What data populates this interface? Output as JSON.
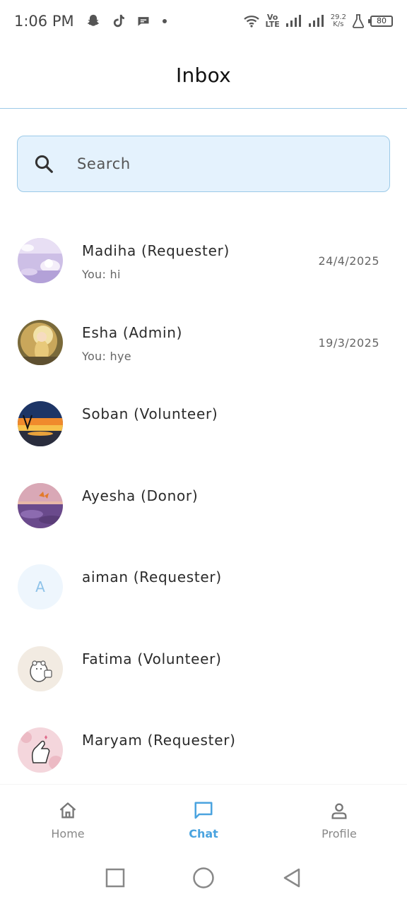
{
  "status_bar": {
    "time": "1:06 PM",
    "network_top": "Vo",
    "network_bottom": "LTE",
    "speed_value": "29.2",
    "speed_unit": "K/s",
    "battery": "80",
    "icons": [
      "snapchat-icon",
      "tiktok-icon",
      "message-icon",
      "dot-icon",
      "wifi-icon",
      "signal-icon",
      "signal-icon",
      "flask-icon",
      "battery-icon"
    ]
  },
  "header": {
    "title": "Inbox"
  },
  "search": {
    "placeholder": "Search"
  },
  "chats": [
    {
      "name": "Madiha  (Requester)",
      "preview": "You: hi",
      "date": "24/4/2025"
    },
    {
      "name": "Esha (Admin)",
      "preview": "You: hye",
      "date": "19/3/2025"
    },
    {
      "name": "Soban  (Volunteer)",
      "preview": "",
      "date": ""
    },
    {
      "name": "Ayesha  (Donor)",
      "preview": "",
      "date": ""
    },
    {
      "name": "aiman (Requester)",
      "preview": "",
      "date": "",
      "avatar_letter": "A"
    },
    {
      "name": "Fatima (Volunteer)",
      "preview": "",
      "date": ""
    },
    {
      "name": "Maryam (Requester)",
      "preview": "",
      "date": ""
    }
  ],
  "bottom_nav": [
    {
      "label": "Home",
      "icon": "home-icon",
      "active": false
    },
    {
      "label": "Chat",
      "icon": "chat-icon",
      "active": true
    },
    {
      "label": "Profile",
      "icon": "profile-icon",
      "active": false
    }
  ],
  "colors": {
    "accent": "#4aa3df",
    "search_bg": "#e4f2fd",
    "border": "#9ccae8"
  }
}
